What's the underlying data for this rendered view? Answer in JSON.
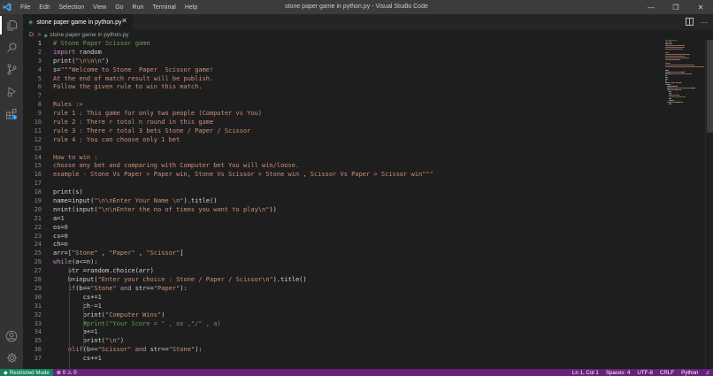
{
  "window": {
    "title": "stone paper game in python.py - Visual Studio Code",
    "menu": [
      "File",
      "Edit",
      "Selection",
      "View",
      "Go",
      "Run",
      "Terminal",
      "Help"
    ],
    "controls": [
      "—",
      "❐",
      "✕"
    ]
  },
  "activity_bar": {
    "items": [
      "explorer-icon",
      "search-icon",
      "source-control-icon",
      "run-debug-icon",
      "extensions-icon"
    ],
    "bottom": [
      "account-icon",
      "settings-gear-icon"
    ]
  },
  "tab": {
    "label": "stone paper game in python.py",
    "close": "✕"
  },
  "breadcrumb": {
    "drive": "D:",
    "sep": ">",
    "file": "stone paper game in python.py"
  },
  "editor": {
    "current_line": 1,
    "lines": [
      [
        {
          "t": "# Stone Paper Scissor game",
          "c": "cmt"
        }
      ],
      [
        {
          "t": "import",
          "c": "kw"
        },
        {
          "t": " random",
          "c": ""
        }
      ],
      [
        {
          "t": "print(",
          "c": ""
        },
        {
          "t": "\"\\n\\n\\n\"",
          "c": "str"
        },
        {
          "t": ")",
          "c": ""
        }
      ],
      [
        {
          "t": "s=",
          "c": ""
        },
        {
          "t": "\"\"\"Welcome to Stone  Paper  Scissor game!",
          "c": "str"
        }
      ],
      [
        {
          "t": "At the end of match result will be publish.",
          "c": "str"
        }
      ],
      [
        {
          "t": "Follow the given rule to win this match.",
          "c": "str"
        }
      ],
      [
        {
          "t": "",
          "c": ""
        }
      ],
      [
        {
          "t": "Rules :>",
          "c": "str"
        }
      ],
      [
        {
          "t": "rule 1 : This game for only two people (Computer vs You)",
          "c": "str"
        }
      ],
      [
        {
          "t": "rule 2 : There r total n round in this game",
          "c": "str"
        }
      ],
      [
        {
          "t": "rule 3 : There r total 3 bets Stone / Paper / Scissor",
          "c": "str"
        }
      ],
      [
        {
          "t": "rule 4 : You can choose only 1 bet",
          "c": "str"
        }
      ],
      [
        {
          "t": "",
          "c": ""
        }
      ],
      [
        {
          "t": "How to win :",
          "c": "str"
        }
      ],
      [
        {
          "t": "choose any bet and comparing with Computer bet You will win/loose.",
          "c": "str"
        }
      ],
      [
        {
          "t": "example - Stone Vs Paper > Paper win, Stone Vs Scissor > Stone win , Scissor Vs Paper > Scissor win\"\"\"",
          "c": "str"
        }
      ],
      [
        {
          "t": "",
          "c": ""
        }
      ],
      [
        {
          "t": "print(s)",
          "c": ""
        }
      ],
      [
        {
          "t": "name=input(",
          "c": ""
        },
        {
          "t": "\"\\n\\nEnter Your Name \\n\"",
          "c": "str"
        },
        {
          "t": ").title()",
          "c": ""
        }
      ],
      [
        {
          "t": "n=int(input(",
          "c": ""
        },
        {
          "t": "\"\\n\\nEnter the no of times you want to play\\n\"",
          "c": "str"
        },
        {
          "t": "))",
          "c": ""
        }
      ],
      [
        {
          "t": "a=",
          "c": ""
        },
        {
          "t": "1",
          "c": "num"
        }
      ],
      [
        {
          "t": "os=",
          "c": ""
        },
        {
          "t": "0",
          "c": "num"
        }
      ],
      [
        {
          "t": "cs=",
          "c": ""
        },
        {
          "t": "0",
          "c": "num"
        }
      ],
      [
        {
          "t": "ch=n",
          "c": ""
        }
      ],
      [
        {
          "t": "arr=[",
          "c": ""
        },
        {
          "t": "\"Stone\"",
          "c": "str"
        },
        {
          "t": " , ",
          "c": ""
        },
        {
          "t": "\"Paper\"",
          "c": "str"
        },
        {
          "t": " , ",
          "c": ""
        },
        {
          "t": "\"Scissor\"",
          "c": "str"
        },
        {
          "t": "]",
          "c": ""
        }
      ],
      [
        {
          "t": "while",
          "c": "kw"
        },
        {
          "t": "(a<=n):",
          "c": ""
        }
      ],
      [
        {
          "t": "    str =random.choice(arr)",
          "c": ""
        }
      ],
      [
        {
          "t": "    b=input(",
          "c": ""
        },
        {
          "t": "\"Enter your choice : Stone / Paper / Scissor\\n\"",
          "c": "str"
        },
        {
          "t": ").title()",
          "c": ""
        }
      ],
      [
        {
          "t": "    ",
          "c": ""
        },
        {
          "t": "if",
          "c": "kw"
        },
        {
          "t": "(b==",
          "c": ""
        },
        {
          "t": "\"Stone\"",
          "c": "str"
        },
        {
          "t": " ",
          "c": ""
        },
        {
          "t": "and",
          "c": "kw"
        },
        {
          "t": " str==",
          "c": ""
        },
        {
          "t": "\"Paper\"",
          "c": "str"
        },
        {
          "t": "):",
          "c": ""
        }
      ],
      [
        {
          "t": "        cs+=",
          "c": ""
        },
        {
          "t": "1",
          "c": "num"
        }
      ],
      [
        {
          "t": "        ch-=",
          "c": ""
        },
        {
          "t": "1",
          "c": "num"
        }
      ],
      [
        {
          "t": "        print(",
          "c": ""
        },
        {
          "t": "\"Computer Wins\"",
          "c": "str"
        },
        {
          "t": ")",
          "c": ""
        }
      ],
      [
        {
          "t": "        ",
          "c": ""
        },
        {
          "t": "#print(\"Your Score = \" , os ,\"/\" , a)",
          "c": "cmt"
        }
      ],
      [
        {
          "t": "        a+=",
          "c": ""
        },
        {
          "t": "1",
          "c": "num"
        }
      ],
      [
        {
          "t": "        print(",
          "c": ""
        },
        {
          "t": "\"\\n\"",
          "c": "str"
        },
        {
          "t": ")",
          "c": ""
        }
      ],
      [
        {
          "t": "    ",
          "c": ""
        },
        {
          "t": "elif",
          "c": "kw"
        },
        {
          "t": "(b==",
          "c": ""
        },
        {
          "t": "\"Scissor\"",
          "c": "str"
        },
        {
          "t": " ",
          "c": ""
        },
        {
          "t": "and",
          "c": "kw"
        },
        {
          "t": " str==",
          "c": ""
        },
        {
          "t": "\"Stone\"",
          "c": "str"
        },
        {
          "t": "):",
          "c": ""
        }
      ],
      [
        {
          "t": "        cs+=",
          "c": ""
        },
        {
          "t": "1",
          "c": "num"
        }
      ]
    ]
  },
  "colors": {
    "cmt": "#6a9955",
    "str": "#ce9178",
    "kw": "#c586c0",
    "num": "#b5cea8",
    "default": "#d4d4d4",
    "statusbar": "#68217a",
    "remote": "#16825d"
  },
  "statusbar": {
    "restricted": "Restricted Mode",
    "errors": "0",
    "warnings": "0",
    "position": "Ln 1, Col 1",
    "spaces": "Spaces: 4",
    "encoding": "UTF-8",
    "eol": "CRLF",
    "language": "Python"
  }
}
